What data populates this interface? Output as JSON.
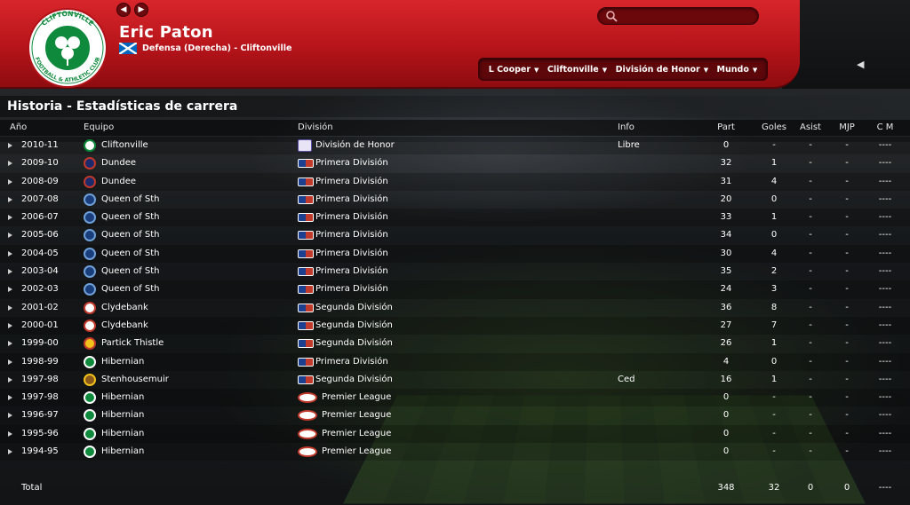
{
  "player": {
    "name": "Eric Paton",
    "subtitle": "Defensa (Derecha) - Cliftonville",
    "flag": "scotland-flag"
  },
  "crest": {
    "text_top": "CLIFTONVILLE",
    "text_bottom": "FOOTBALL & ATHLETIC CLUB"
  },
  "nav": {
    "back": "◀",
    "forward": "▶"
  },
  "search": {
    "placeholder": ""
  },
  "breadcrumbs": [
    {
      "label": "L Cooper"
    },
    {
      "label": "Cliftonville"
    },
    {
      "label": "División de Honor"
    },
    {
      "label": "Mundo"
    }
  ],
  "collapse": "◀",
  "section_title": "Historia - Estadísticas de carrera",
  "columns": {
    "year": "Año",
    "team": "Equipo",
    "division": "División",
    "info": "Info",
    "apps": "Part",
    "goals": "Goles",
    "assists": "Asist",
    "mom": "MJP",
    "rating": "C M"
  },
  "rows": [
    {
      "year": "2010-11",
      "team": "Cliftonville",
      "team_icon": "cliftonville-crest",
      "division": "División de Honor",
      "div_icon": "dh",
      "info": "Libre",
      "apps": "0",
      "goals": "-",
      "assists": "-",
      "mom": "-",
      "rating": "----"
    },
    {
      "year": "2009-10",
      "team": "Dundee",
      "team_icon": "dundee-crest",
      "division": "Primera División",
      "div_icon": "sfl",
      "info": "",
      "apps": "32",
      "goals": "1",
      "assists": "-",
      "mom": "-",
      "rating": "----"
    },
    {
      "year": "2008-09",
      "team": "Dundee",
      "team_icon": "dundee-crest",
      "division": "Primera División",
      "div_icon": "sfl",
      "info": "",
      "apps": "31",
      "goals": "4",
      "assists": "-",
      "mom": "-",
      "rating": "----"
    },
    {
      "year": "2007-08",
      "team": "Queen of Sth",
      "team_icon": "qos-crest",
      "division": "Primera División",
      "div_icon": "sfl",
      "info": "",
      "apps": "20",
      "goals": "0",
      "assists": "-",
      "mom": "-",
      "rating": "----"
    },
    {
      "year": "2006-07",
      "team": "Queen of Sth",
      "team_icon": "qos-crest",
      "division": "Primera División",
      "div_icon": "sfl",
      "info": "",
      "apps": "33",
      "goals": "1",
      "assists": "-",
      "mom": "-",
      "rating": "----"
    },
    {
      "year": "2005-06",
      "team": "Queen of Sth",
      "team_icon": "qos-crest",
      "division": "Primera División",
      "div_icon": "sfl",
      "info": "",
      "apps": "34",
      "goals": "0",
      "assists": "-",
      "mom": "-",
      "rating": "----"
    },
    {
      "year": "2004-05",
      "team": "Queen of Sth",
      "team_icon": "qos-crest",
      "division": "Primera División",
      "div_icon": "sfl",
      "info": "",
      "apps": "30",
      "goals": "4",
      "assists": "-",
      "mom": "-",
      "rating": "----"
    },
    {
      "year": "2003-04",
      "team": "Queen of Sth",
      "team_icon": "qos-crest",
      "division": "Primera División",
      "div_icon": "sfl",
      "info": "",
      "apps": "35",
      "goals": "2",
      "assists": "-",
      "mom": "-",
      "rating": "----"
    },
    {
      "year": "2002-03",
      "team": "Queen of Sth",
      "team_icon": "qos-crest",
      "division": "Primera División",
      "div_icon": "sfl",
      "info": "",
      "apps": "24",
      "goals": "3",
      "assists": "-",
      "mom": "-",
      "rating": "----"
    },
    {
      "year": "2001-02",
      "team": "Clydebank",
      "team_icon": "clydebank-crest",
      "division": "Segunda División",
      "div_icon": "sfl",
      "info": "",
      "apps": "36",
      "goals": "8",
      "assists": "-",
      "mom": "-",
      "rating": "----"
    },
    {
      "year": "2000-01",
      "team": "Clydebank",
      "team_icon": "clydebank-crest",
      "division": "Segunda División",
      "div_icon": "sfl",
      "info": "",
      "apps": "27",
      "goals": "7",
      "assists": "-",
      "mom": "-",
      "rating": "----"
    },
    {
      "year": "1999-00",
      "team": "Partick Thistle",
      "team_icon": "partick-crest",
      "division": "Segunda División",
      "div_icon": "sfl",
      "info": "",
      "apps": "26",
      "goals": "1",
      "assists": "-",
      "mom": "-",
      "rating": "----"
    },
    {
      "year": "1998-99",
      "team": "Hibernian",
      "team_icon": "hibernian-crest",
      "division": "Primera División",
      "div_icon": "sfl",
      "info": "",
      "apps": "4",
      "goals": "0",
      "assists": "-",
      "mom": "-",
      "rating": "----"
    },
    {
      "year": "1997-98",
      "team": "Stenhousemuir",
      "team_icon": "stenhousemuir-crest",
      "division": "Segunda División",
      "div_icon": "sfl",
      "info": "Ced",
      "apps": "16",
      "goals": "1",
      "assists": "-",
      "mom": "-",
      "rating": "----"
    },
    {
      "year": "1997-98",
      "team": "Hibernian",
      "team_icon": "hibernian-crest",
      "division": "Premier League",
      "div_icon": "pl",
      "info": "",
      "apps": "0",
      "goals": "-",
      "assists": "-",
      "mom": "-",
      "rating": "----"
    },
    {
      "year": "1996-97",
      "team": "Hibernian",
      "team_icon": "hibernian-crest",
      "division": "Premier League",
      "div_icon": "pl",
      "info": "",
      "apps": "0",
      "goals": "-",
      "assists": "-",
      "mom": "-",
      "rating": "----"
    },
    {
      "year": "1995-96",
      "team": "Hibernian",
      "team_icon": "hibernian-crest",
      "division": "Premier League",
      "div_icon": "pl",
      "info": "",
      "apps": "0",
      "goals": "-",
      "assists": "-",
      "mom": "-",
      "rating": "----"
    },
    {
      "year": "1994-95",
      "team": "Hibernian",
      "team_icon": "hibernian-crest",
      "division": "Premier League",
      "div_icon": "pl",
      "info": "",
      "apps": "0",
      "goals": "-",
      "assists": "-",
      "mom": "-",
      "rating": "----"
    }
  ],
  "total": {
    "label": "Total",
    "apps": "348",
    "goals": "32",
    "assists": "0",
    "mom": "0",
    "rating": "----"
  },
  "colors": {
    "header_red": "#c41b20",
    "crest_green": "#0f8a3c"
  }
}
